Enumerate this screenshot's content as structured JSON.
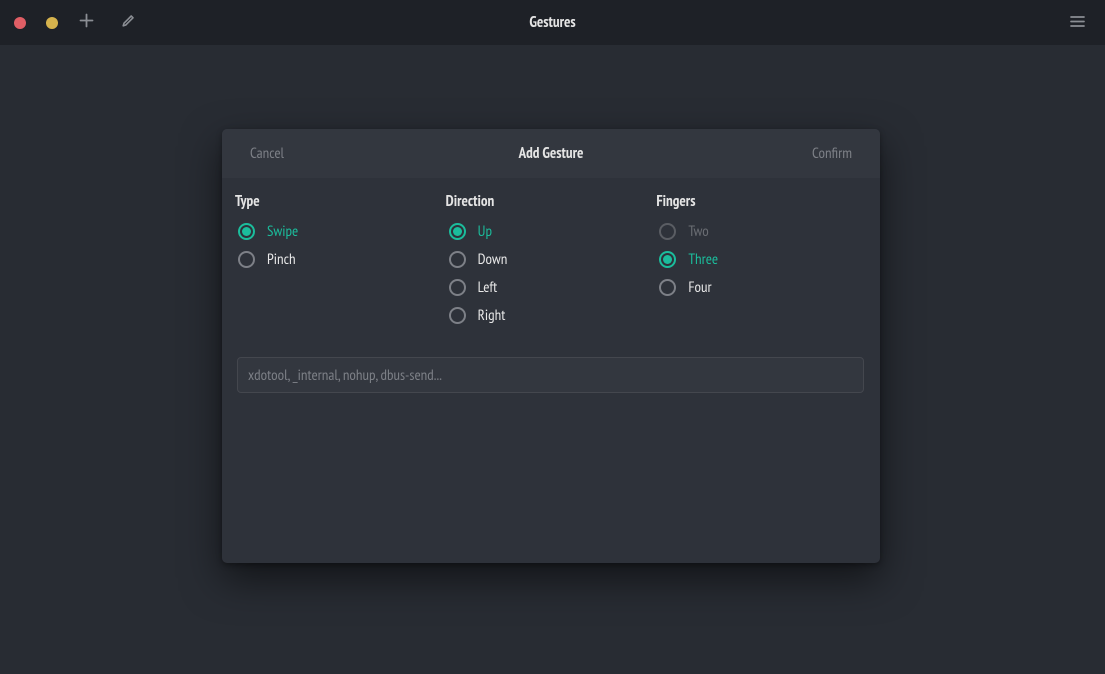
{
  "app_title": "Gestures",
  "dialog": {
    "title": "Add Gesture",
    "cancel": "Cancel",
    "confirm": "Confirm",
    "type_heading": "Type",
    "direction_heading": "Direction",
    "fingers_heading": "Fingers",
    "type": {
      "swipe": "Swipe",
      "pinch": "Pinch"
    },
    "direction": {
      "up": "Up",
      "down": "Down",
      "left": "Left",
      "right": "Right"
    },
    "fingers": {
      "two": "Two",
      "three": "Three",
      "four": "Four"
    },
    "command_value": "",
    "command_placeholder": "xdotool, _internal, nohup, dbus-send...",
    "selected": {
      "type": "swipe",
      "direction": "up",
      "fingers": "three"
    },
    "disabled_fingers": [
      "two"
    ]
  },
  "icons": {
    "close": "close-dot",
    "minimize": "minimize-dot",
    "add": "plus-icon",
    "edit": "pencil-icon",
    "menu": "hamburger-icon"
  }
}
